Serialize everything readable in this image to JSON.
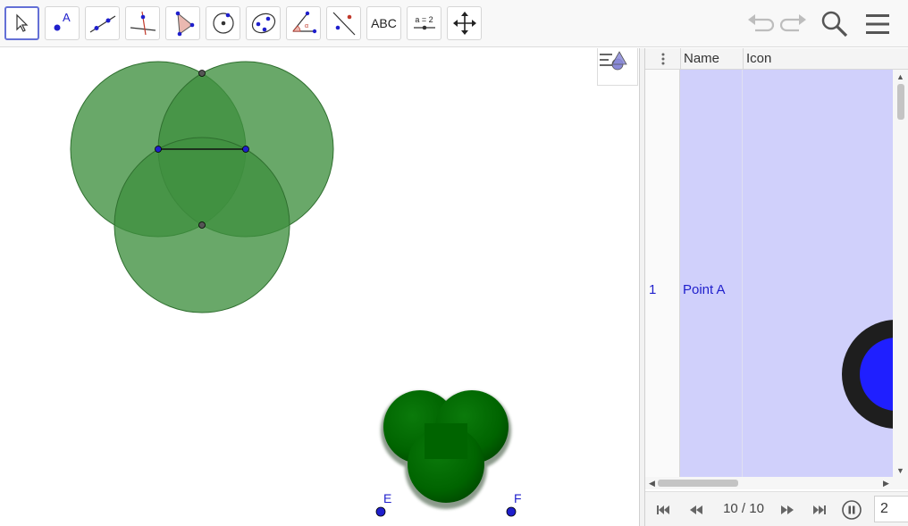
{
  "toolbar": {
    "tools": [
      {
        "name": "move-tool",
        "label": "",
        "active": true
      },
      {
        "name": "point-tool",
        "label": "A"
      },
      {
        "name": "line-tool",
        "label": ""
      },
      {
        "name": "perpendicular-line-tool",
        "label": ""
      },
      {
        "name": "polygon-tool",
        "label": ""
      },
      {
        "name": "circle-center-point-tool",
        "label": ""
      },
      {
        "name": "ellipse-tool",
        "label": ""
      },
      {
        "name": "angle-tool",
        "label": ""
      },
      {
        "name": "reflect-tool",
        "label": ""
      },
      {
        "name": "text-tool",
        "label": "ABC"
      },
      {
        "name": "slider-tool",
        "label": "a = 2"
      },
      {
        "name": "move-graphics-view-tool",
        "label": ""
      }
    ],
    "right_icons": [
      "undo-icon",
      "redo-icon",
      "search-icon",
      "menu-icon"
    ]
  },
  "graphics": {
    "points": [
      {
        "label": "E"
      },
      {
        "label": "F"
      }
    ],
    "colors": {
      "circle_fill": "#3f8f3f",
      "shape_fill": "#006400",
      "point": "#1f1fcc"
    }
  },
  "spreadsheet": {
    "columns": [
      "Name",
      "Icon"
    ],
    "rows": [
      {
        "number": "1",
        "name": "Point A"
      }
    ],
    "highlight_color": "#d0d0fb"
  },
  "playback": {
    "step_counter": "10 / 10",
    "speed_value": "2"
  }
}
